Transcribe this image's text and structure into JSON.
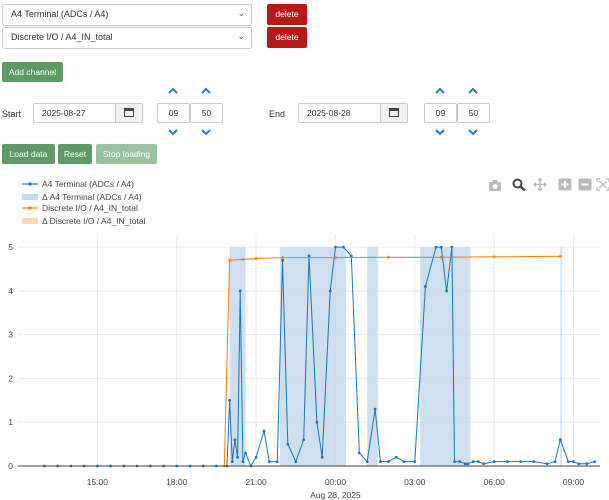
{
  "channels": [
    {
      "value": "A4 Terminal (ADCs / A4)",
      "delete_label": "delete"
    },
    {
      "value": "Discrete I/O / A4_IN_total",
      "delete_label": "delete"
    }
  ],
  "add_channel_label": "Add channel",
  "start": {
    "label": "Start",
    "date": "2025-08-27",
    "hour": "09",
    "minute": "50"
  },
  "end": {
    "label": "End",
    "date": "2025-08-28",
    "hour": "09",
    "minute": "50"
  },
  "buttons": {
    "load": "Load data",
    "reset": "Reset",
    "stop": "Stop loading"
  },
  "colors": {
    "danger": "#b31b1b",
    "success": "#5d9a64",
    "series_a4": "#1f77b4",
    "series_di": "#ff7f0e",
    "band_a4": "#c6dbef",
    "band_di": "#fdd9b5"
  },
  "icons": [
    "camera-icon",
    "zoom-icon",
    "pan-icon",
    "zoom-in-icon",
    "zoom-out-icon",
    "autoscale-icon"
  ],
  "chart_data": {
    "type": "line",
    "x_ticks": [
      "15:00",
      "18:00",
      "21:00",
      "00:00",
      "03:00",
      "06:00",
      "09:00"
    ],
    "x_date_label": "Aug 28, 2025",
    "ylim": [
      0,
      5.3
    ],
    "y_ticks": [
      "0",
      "1",
      "2",
      "3",
      "4",
      "5"
    ],
    "grid": true,
    "legend_position": "top-left",
    "legend": [
      "A4 Terminal (ADCs / A4)",
      "Δ A4 Terminal (ADCs / A4)",
      "Discrete I/O / A4_IN_total",
      "Δ Discrete I/O / A4_IN_total"
    ],
    "series": [
      {
        "name": "A4 Terminal (ADCs / A4)",
        "hours": [
          13.0,
          13.5,
          14.0,
          14.5,
          15.0,
          15.5,
          16.0,
          16.5,
          17.0,
          17.5,
          18.0,
          18.5,
          19.0,
          19.5,
          19.9,
          20.0,
          20.1,
          20.2,
          20.3,
          20.4,
          20.5,
          20.6,
          20.8,
          21.0,
          21.3,
          21.5,
          21.8,
          22.0,
          22.2,
          22.5,
          22.8,
          23.0,
          23.3,
          23.5,
          23.8,
          24.0,
          24.3,
          24.6,
          24.9,
          25.2,
          25.5,
          25.7,
          26.0,
          26.3,
          26.6,
          27.0,
          27.4,
          27.8,
          28.0,
          28.2,
          28.4,
          28.5,
          28.7,
          28.9,
          29.0,
          29.2,
          29.4,
          29.6,
          30.0,
          30.5,
          31.0,
          31.5,
          32.0,
          32.3,
          32.5,
          32.8,
          33.0,
          33.2,
          33.5,
          33.8
        ],
        "values": [
          0,
          0,
          0,
          0,
          0,
          0,
          0,
          0,
          0,
          0,
          0,
          0,
          0,
          0,
          0,
          1.5,
          0.1,
          0.6,
          0.2,
          4.0,
          0.1,
          0.3,
          0.0,
          0.2,
          0.8,
          0.1,
          0.1,
          4.7,
          0.5,
          0.1,
          0.6,
          4.8,
          1.0,
          0.2,
          4.0,
          5.0,
          5.0,
          4.8,
          0.3,
          0.1,
          1.3,
          0.1,
          0.1,
          0.2,
          0.1,
          0.1,
          4.1,
          5.0,
          5.0,
          4.0,
          5.0,
          0.1,
          0.1,
          0.05,
          0.05,
          0.1,
          0.1,
          0.05,
          0.1,
          0.1,
          0.1,
          0.1,
          0.05,
          0.1,
          0.6,
          0.1,
          0.1,
          0.05,
          0.05,
          0.1
        ]
      },
      {
        "name": "Discrete I/O / A4_IN_total",
        "hours": [
          19.8,
          20.0,
          20.5,
          21.0,
          22.0,
          24.0,
          26.0,
          28.0,
          30.0,
          32.5
        ],
        "values": [
          0,
          4.7,
          4.72,
          4.74,
          4.76,
          4.76,
          4.77,
          4.77,
          4.78,
          4.79
        ]
      }
    ],
    "delta_bands_hours": [
      [
        20.0,
        20.6
      ],
      [
        21.9,
        24.4
      ],
      [
        25.2,
        25.6
      ],
      [
        27.2,
        29.1
      ],
      [
        32.5,
        32.55
      ]
    ]
  }
}
